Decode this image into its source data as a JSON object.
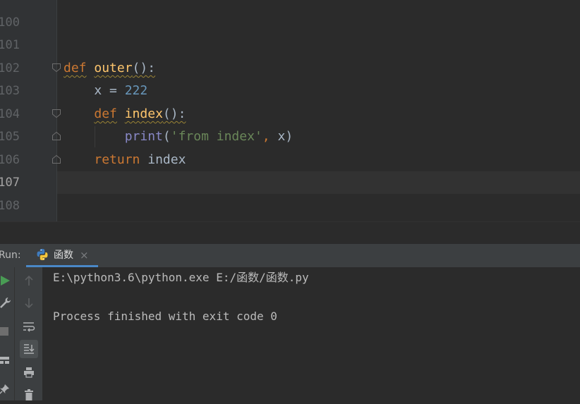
{
  "editor": {
    "line_numbers": [
      "100",
      "101",
      "102",
      "103",
      "104",
      "105",
      "106",
      "107",
      "108"
    ],
    "current_line": "107",
    "code": {
      "l102": {
        "kw": "def",
        "fn": "outer",
        "rest": "():"
      },
      "l103": {
        "lhs": "x",
        "op": " = ",
        "num": "222"
      },
      "l104": {
        "kw": "def",
        "fn": "index",
        "rest": "():"
      },
      "l105": {
        "builtin": "print",
        "open": "(",
        "str": "'from index'",
        "comma": ", ",
        "arg": "x",
        "close": ")"
      },
      "l106": {
        "kw": "return",
        "rest": " index"
      }
    }
  },
  "run_panel": {
    "label": "Run:",
    "tab_label": "函数",
    "tab_close": "×",
    "console": [
      "E:\\python3.6\\python.exe E:/函数/函数.py",
      "",
      "Process finished with exit code 0"
    ]
  },
  "colors": {
    "keyword": "#cc7832",
    "function": "#ffc66d",
    "builtin": "#8888c6",
    "number": "#6897bb",
    "string": "#6a8759",
    "run_accent": "#4a88c7",
    "run_green": "#499c54"
  }
}
